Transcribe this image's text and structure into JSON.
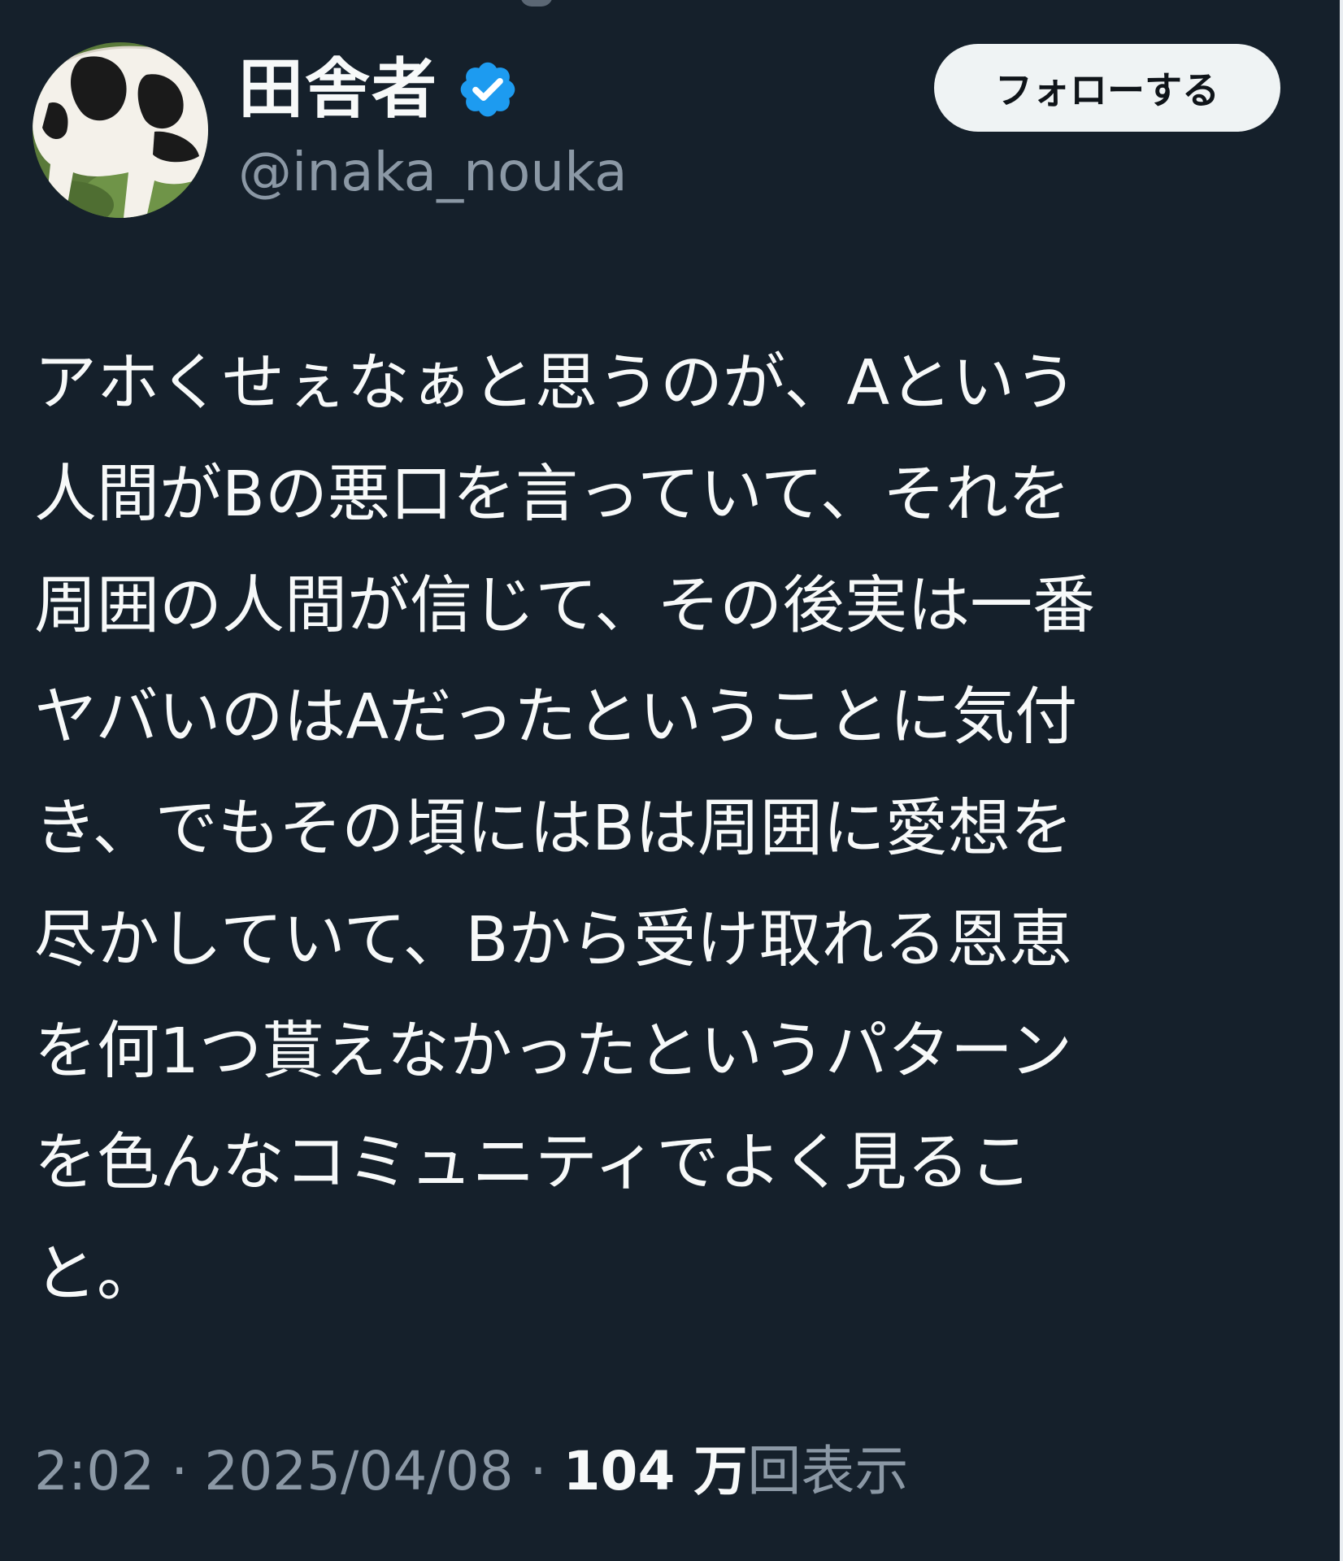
{
  "tweet": {
    "author": {
      "display_name": "田舎者",
      "handle": "@inaka_nouka",
      "verified": true,
      "avatar_icon": "cow-avatar"
    },
    "follow_label": "フォローする",
    "text_lines": [
      "アホくせぇなぁと思うのが、Aという",
      "人間がBの悪口を言っていて、それを",
      "周囲の人間が信じて、その後実は一番",
      "ヤバいのはAだったということに気付",
      "き、でもその頃にはBは周囲に愛想を",
      "尽かしていて、Bから受け取れる恩恵",
      "を何1つ貰えなかったというパターン",
      "を色んなコミュニティでよく見るこ",
      "と。"
    ],
    "meta": {
      "time": "2:02",
      "separator": "·",
      "date": "2025/04/08",
      "views_count": "104 万",
      "views_label": "回表示"
    }
  },
  "colors": {
    "background": "#15202b",
    "text_primary": "#f7f9f9",
    "text_secondary": "#8b98a5",
    "verified_blue": "#1d9bf0",
    "button_bg": "#eff3f4",
    "button_text": "#0f1419"
  }
}
